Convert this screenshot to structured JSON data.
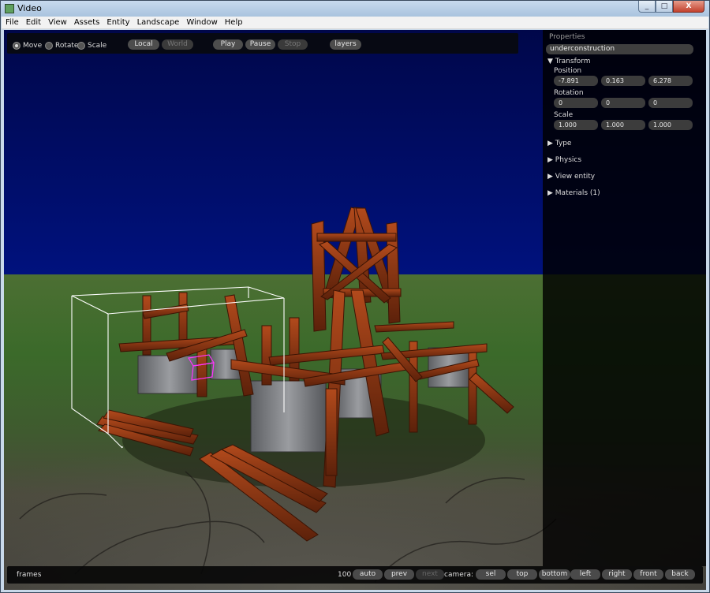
{
  "window": {
    "title": "Video",
    "buttons": {
      "minimize": "_",
      "maximize": "□",
      "close": "X"
    }
  },
  "menu": [
    "File",
    "Edit",
    "View",
    "Assets",
    "Entity",
    "Landscape",
    "Window",
    "Help"
  ],
  "toolbar": {
    "modes": [
      {
        "label": "Move",
        "selected": true
      },
      {
        "label": "Rotate",
        "selected": false
      },
      {
        "label": "Scale",
        "selected": false
      }
    ],
    "local": "Local",
    "world": "World",
    "play": "Play",
    "pause": "Pause",
    "stop": "Stop",
    "layers": "layers"
  },
  "properties": {
    "header": "Properties",
    "entity_name": "underconstruction",
    "transform": {
      "label": "▼ Transform",
      "position_label": "Position",
      "position": [
        "-7.891",
        "0.163",
        "6.278"
      ],
      "rotation_label": "Rotation",
      "rotation": [
        "0",
        "0",
        "0"
      ],
      "scale_label": "Scale",
      "scale": [
        "1.000",
        "1.000",
        "1.000"
      ]
    },
    "type": "▶ Type",
    "physics": "▶ Physics",
    "view_entity": "▶ View entity",
    "materials": "▶ Materials (1)"
  },
  "timeline": {
    "frames_label": "frames",
    "frame_count": "100",
    "auto": "auto",
    "prev": "prev",
    "next": "next",
    "camera_label": "camera:",
    "cameras": [
      "sel",
      "top",
      "bottom",
      "left",
      "right",
      "front",
      "back"
    ]
  },
  "colors": {
    "sky": "#000a6e",
    "ground": "#3f6a2a",
    "wood": "#8a3512",
    "selection_box": "#ffffff",
    "pivot_marker": "#ff33ff"
  }
}
